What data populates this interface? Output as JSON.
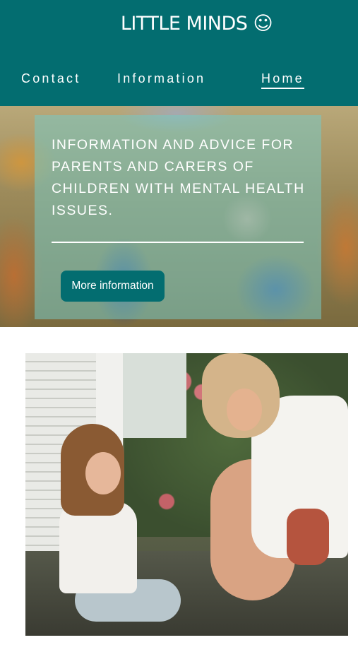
{
  "header": {
    "logo_text": "LITTLE MINDS ☺",
    "background_color": "#036d70"
  },
  "nav": {
    "items": [
      {
        "label": "Contact"
      },
      {
        "label": "Information"
      },
      {
        "label": "Home",
        "active": true
      }
    ]
  },
  "hero": {
    "headline": "INFORMATION AND ADVICE FOR PARENTS AND CARERS OF CHILDREN WITH MENTAL HEALTH ISSUES.",
    "button_label": "More information",
    "panel_color": "#78c8c3"
  },
  "photo": {
    "icon": "mother-and-child-gardening-photo"
  }
}
